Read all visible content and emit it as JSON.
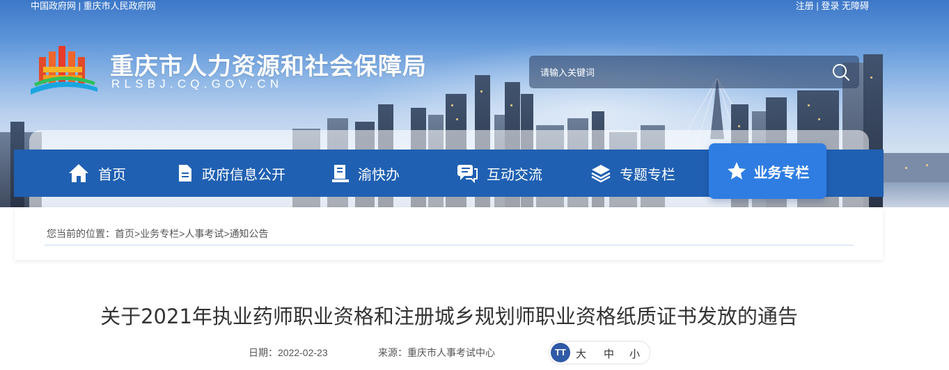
{
  "top_bar": {
    "gov_link": "中国政府网",
    "separator": "|",
    "city_link": "重庆市人民政府网",
    "register": "注册",
    "login": "登录",
    "accessibility": "无障碍"
  },
  "site": {
    "title": "重庆市人力资源和社会保障局",
    "domain": "RLSBJ.CQ.GOV.CN"
  },
  "search": {
    "placeholder": "请输入关键词",
    "icon": "search-icon"
  },
  "nav": {
    "items": [
      {
        "label": "首页",
        "icon": "home-icon"
      },
      {
        "label": "政府信息公开",
        "icon": "document-icon"
      },
      {
        "label": "渝快办",
        "icon": "handbook-icon"
      },
      {
        "label": "互动交流",
        "icon": "chat-icon"
      },
      {
        "label": "专题专栏",
        "icon": "layers-icon"
      }
    ],
    "active": {
      "label": "业务专栏",
      "icon": "star-icon"
    }
  },
  "breadcrumb": {
    "prefix": "您当前的位置：",
    "items": [
      "首页",
      "业务专栏",
      "人事考试",
      "通知公告"
    ],
    "separator": ">"
  },
  "article": {
    "title": "关于2021年执业药师职业资格和注册城乡规划师职业资格纸质证书发放的通告",
    "date_label": "日期：",
    "date": "2022-02-23",
    "source_label": "来源：",
    "source": "重庆市人事考试中心",
    "font_icon": "TT",
    "font_large": "大",
    "font_medium": "中",
    "font_small": "小"
  },
  "colors": {
    "nav_bg": "#2060b2",
    "nav_active": "#2f7de2",
    "title_text": "#333333"
  }
}
